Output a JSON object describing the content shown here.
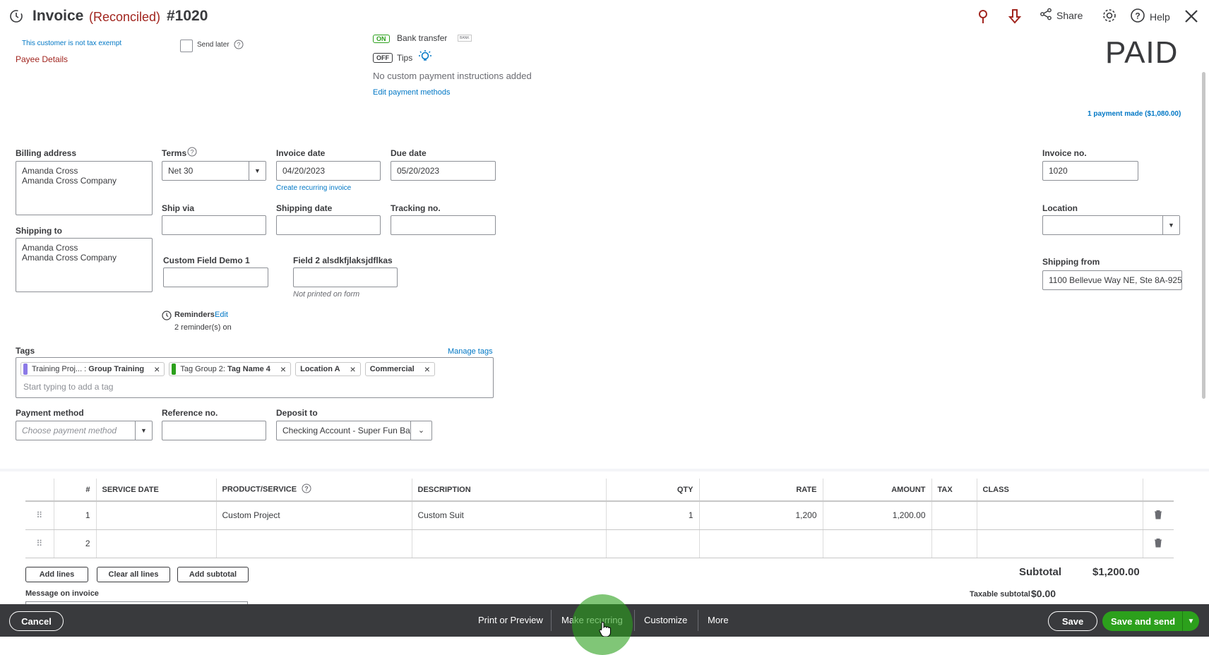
{
  "header": {
    "title": "Invoice",
    "status": "(Reconciled)",
    "number": "#1020",
    "share_label": "Share",
    "help_label": "Help",
    "colors": {
      "accent_red": "#a1251f"
    }
  },
  "top": {
    "tax_exempt_note": "This customer is not tax exempt",
    "payee_details": "Payee Details",
    "send_later_label": "Send later",
    "bank_toggle": "ON",
    "bank_label": "Bank transfer",
    "bank_badge": "BANK",
    "tips_toggle": "OFF",
    "tips_label": "Tips",
    "no_instructions": "No custom payment instructions added",
    "edit_payment_methods": "Edit payment methods",
    "paid_stamp": "PAID",
    "payment_made": "1 payment made ($1,080.00)"
  },
  "form": {
    "billing_address_label": "Billing address",
    "billing_line1": "Amanda Cross",
    "billing_line2": "Amanda Cross Company",
    "terms_label": "Terms",
    "terms_value": "Net 30",
    "invoice_date_label": "Invoice date",
    "invoice_date_value": "04/20/2023",
    "due_date_label": "Due date",
    "due_date_value": "05/20/2023",
    "create_recurring": "Create recurring invoice",
    "invoice_no_label": "Invoice no.",
    "invoice_no_value": "1020",
    "ship_via_label": "Ship via",
    "shipping_date_label": "Shipping date",
    "tracking_label": "Tracking no.",
    "location_label": "Location",
    "shipping_to_label": "Shipping to",
    "shipping_line1": "Amanda Cross",
    "shipping_line2": "Amanda Cross Company",
    "custom_field1_label": "Custom Field Demo 1",
    "custom_field2_label": "Field 2 alsdkfjlaksjdflkas",
    "not_printed": "Not printed on form",
    "shipping_from_label": "Shipping from",
    "shipping_from_value": "1100 Bellevue Way NE, Ste 8A-925",
    "reminders_label": "Reminders",
    "reminders_edit": "Edit",
    "reminders_count": "2 reminder(s) on",
    "tags_label": "Tags",
    "manage_tags": "Manage tags",
    "tag_placeholder": "Start typing to add a tag",
    "tags": [
      {
        "group": "Training Proj... : ",
        "name": "Group Training",
        "color": "#8c7ae6"
      },
      {
        "group": "Tag Group 2: ",
        "name": "Tag Name 4",
        "color": "#2ca01c"
      },
      {
        "group": "",
        "name": "Location A",
        "color": ""
      },
      {
        "group": "",
        "name": "Commercial",
        "color": ""
      }
    ],
    "payment_method_label": "Payment method",
    "payment_method_placeholder": "Choose payment method",
    "reference_label": "Reference no.",
    "deposit_label": "Deposit to",
    "deposit_value": "Checking Account - Super Fun Ba"
  },
  "table": {
    "headers": [
      "#",
      "SERVICE DATE",
      "PRODUCT/SERVICE",
      "DESCRIPTION",
      "QTY",
      "RATE",
      "AMOUNT",
      "TAX",
      "CLASS"
    ],
    "rows": [
      {
        "num": "1",
        "service_date": "",
        "product": "Custom Project",
        "description": "Custom Suit",
        "qty": "1",
        "rate": "1,200",
        "amount": "1,200.00",
        "tax": "",
        "class": ""
      },
      {
        "num": "2",
        "service_date": "",
        "product": "",
        "description": "",
        "qty": "",
        "rate": "",
        "amount": "",
        "tax": "",
        "class": ""
      }
    ],
    "add_lines": "Add lines",
    "clear_lines": "Clear all lines",
    "add_subtotal": "Add subtotal",
    "message_label": "Message on invoice",
    "subtotal_label": "Subtotal",
    "subtotal_value": "$1,200.00",
    "taxable_label": "Taxable subtotal",
    "taxable_value": "$0.00"
  },
  "footer": {
    "cancel": "Cancel",
    "print_preview": "Print or Preview",
    "make_recurring": "Make recurring",
    "customize": "Customize",
    "more": "More",
    "save": "Save",
    "save_send": "Save and send",
    "colors": {
      "bar": "#393a3d",
      "primary": "#2ca01c"
    }
  }
}
